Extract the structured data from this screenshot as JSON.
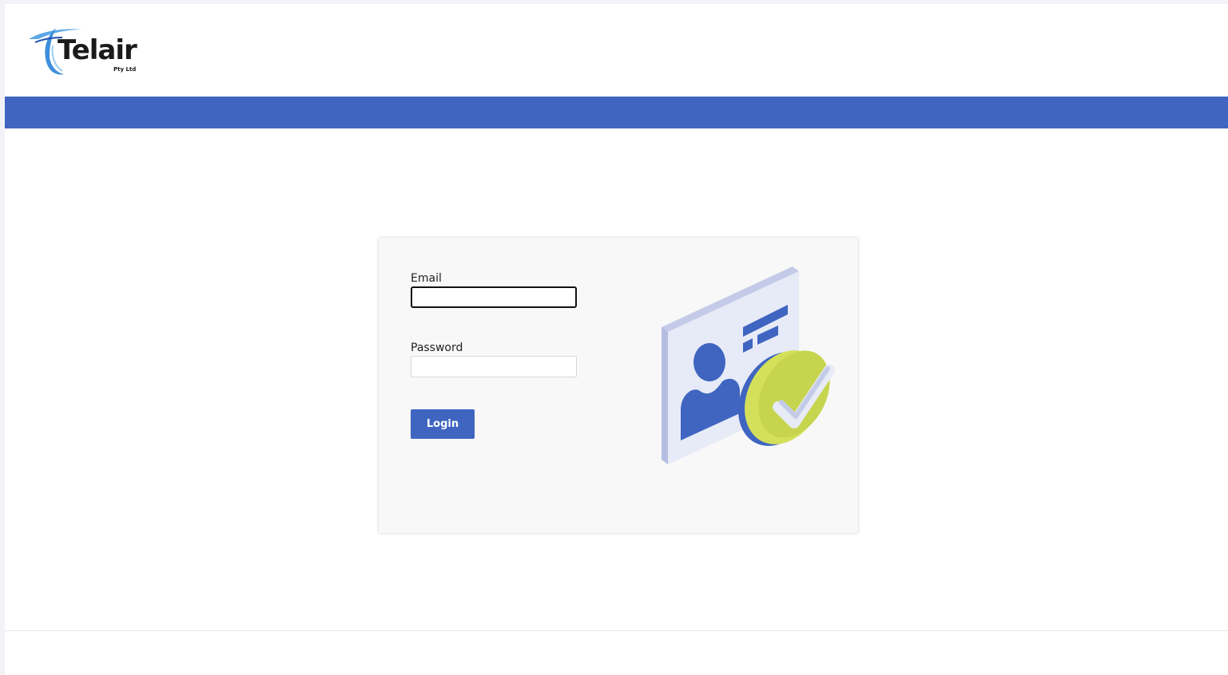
{
  "header": {
    "logo_text": "Telair",
    "logo_subtext": "Pty Ltd"
  },
  "colors": {
    "brand_blue": "#3f65c1",
    "accent_green": "#d4e05a",
    "card_background": "#f8f8f8"
  },
  "login": {
    "email_label": "Email",
    "email_value": "",
    "password_label": "Password",
    "password_value": "",
    "login_label": "Login"
  },
  "illustration": {
    "icon": "id-card-verified-icon"
  }
}
